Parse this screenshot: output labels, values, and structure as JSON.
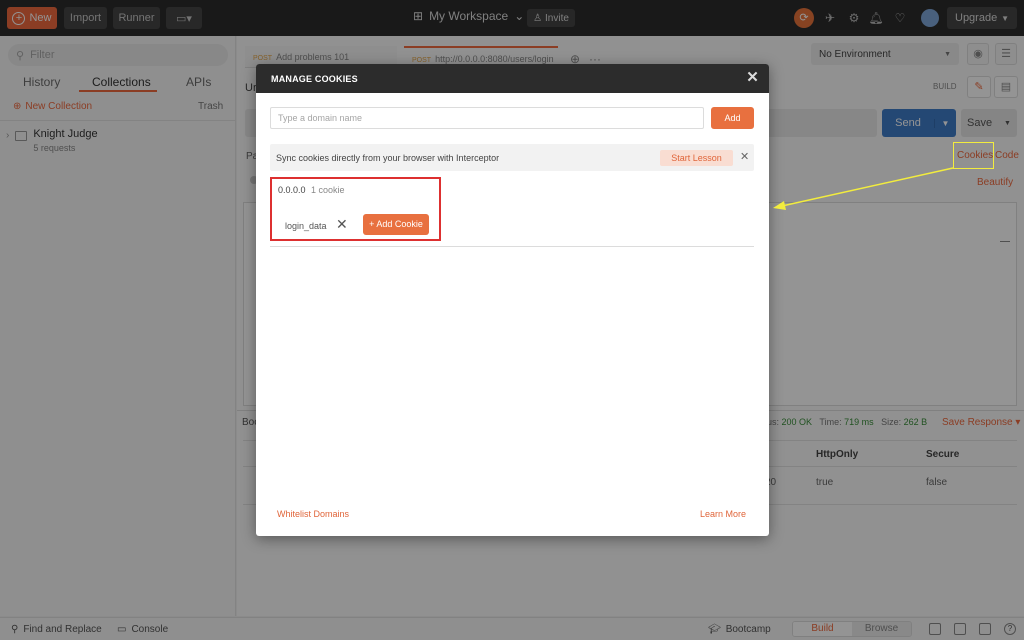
{
  "header": {
    "new_label": "New",
    "import_label": "Import",
    "runner_label": "Runner",
    "workspace_label": "My Workspace",
    "invite_label": "Invite",
    "upgrade_label": "Upgrade"
  },
  "sidebar": {
    "filter_placeholder": "Filter",
    "tabs": [
      {
        "label": "History"
      },
      {
        "label": "Collections"
      },
      {
        "label": "APIs"
      }
    ],
    "new_collection_label": "New Collection",
    "trash_label": "Trash",
    "collections": [
      {
        "name": "Knight Judge",
        "count": "5 requests"
      }
    ]
  },
  "main": {
    "tabs": [
      {
        "method": "POST",
        "title": "Add problems 101"
      },
      {
        "method": "POST",
        "title": "http://0.0.0.0:8080/users/login"
      }
    ],
    "environment": "No Environment",
    "request_title_fragment": "Ur",
    "build_label": "BUILD",
    "send_label": "Send",
    "save_label": "Save",
    "params_fragment": "Pa",
    "cookies_label": "Cookies",
    "code_label": "Code",
    "beautify_label": "Beautify",
    "response_fragment": "Boo",
    "status": {
      "status_fragment": "us:",
      "status_value": "200 OK",
      "time_label": "Time:",
      "time_value": "719 ms",
      "size_label": "Size:",
      "size_value": "262 B"
    },
    "save_response_label": "Save Response",
    "columns": [
      "HttpOnly",
      "Secure"
    ],
    "row": {
      "fragment": "20",
      "httponly": "true",
      "secure": "false"
    }
  },
  "footer": {
    "find_replace_label": "Find and Replace",
    "console_label": "Console",
    "bootcamp_label": "Bootcamp",
    "build_label": "Build",
    "browse_label": "Browse"
  },
  "modal": {
    "title": "MANAGE COOKIES",
    "domain_placeholder": "Type a domain name",
    "add_label": "Add",
    "sync_text": "Sync cookies directly from your browser with Interceptor",
    "start_lesson_label": "Start Lesson",
    "domains": [
      {
        "name": "0.0.0.0",
        "count": "1 cookie",
        "cookies": [
          "login_data"
        ]
      }
    ],
    "add_cookie_label": "+ Add Cookie",
    "whitelist_label": "Whitelist Domains",
    "learn_more_label": "Learn More"
  },
  "colors": {
    "accent": "#ef6a3f",
    "header_bg": "#2c2c2c",
    "send_blue": "#3f7cc9",
    "annotation_red": "#dd3030",
    "annotation_yellow": "#f2ec3e"
  }
}
